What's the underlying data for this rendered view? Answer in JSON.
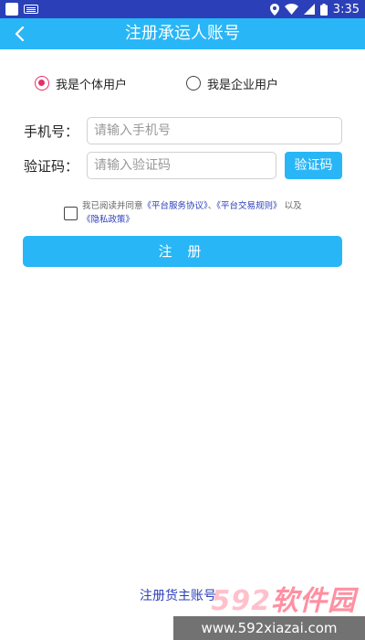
{
  "status_bar": {
    "time": "3:35"
  },
  "app_bar": {
    "title": "注册承运人账号"
  },
  "account_type": {
    "options": [
      {
        "label": "我是个体用户",
        "selected": true
      },
      {
        "label": "我是企业用户",
        "selected": false
      }
    ]
  },
  "form": {
    "phone_label": "手机号：",
    "phone_placeholder": "请输入手机号",
    "code_label": "验证码：",
    "code_placeholder": "请输入验证码",
    "get_code_button": "验证码"
  },
  "agreement": {
    "prefix": "我已阅读并同意",
    "service_link": "《平台服务协议》",
    "separator": "、",
    "trade_link": "《平台交易规则》",
    "and_text": "以及",
    "privacy_link": "《隐私政策》",
    "checked": false
  },
  "register_button": "注 册",
  "cargo_owner_link": "注册货主账号",
  "watermark": {
    "brand_num": "592",
    "brand_text": "软件园",
    "url": "www.592xiazai.com"
  },
  "colors": {
    "status_bar": "#2b3fb8",
    "app_bar": "#29b6f6",
    "accent": "#e5306a",
    "link": "#2b3fb8"
  }
}
